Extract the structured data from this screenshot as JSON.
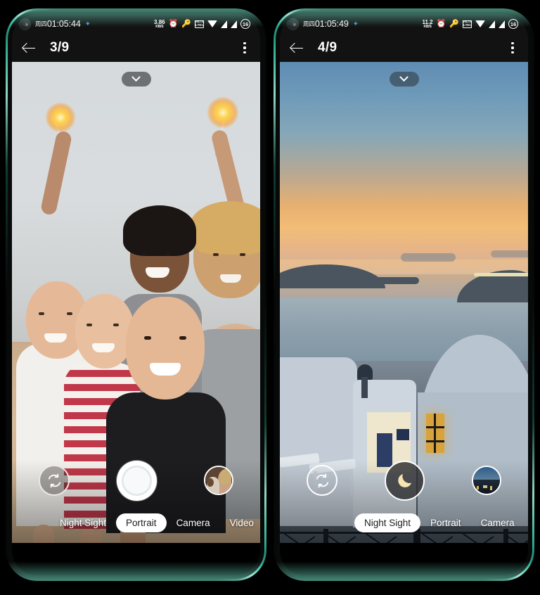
{
  "phones": [
    {
      "id": "phone-left",
      "statusbar": {
        "day_of_week": "周四",
        "time": "01:05:44",
        "net_speed_value": "3.86",
        "net_speed_unit": "KB/S",
        "alarm_icon": "alarm-clock-icon",
        "key_icon": "vpn-key-icon",
        "volte_line1": "VoLTE",
        "volte_line2": "LTE1",
        "wifi_icon": "wifi-icon",
        "signal_icon_1": "signal-bars-icon",
        "signal_icon_2": "signal-bars-icon",
        "battery_level": "16",
        "sync_icon": "sync-status-icon"
      },
      "appbar": {
        "back_icon": "back-arrow-icon",
        "title": "3/9",
        "overflow_icon": "more-options-icon"
      },
      "viewfinder": {
        "scene": "group-selfie-with-sparklers",
        "expand_icon": "chevron-down-icon"
      },
      "controls": {
        "flip_icon": "flip-camera-icon",
        "shutter_label": "shutter-button",
        "shutter_icon": "",
        "thumbnail_label": "last-photo-thumbnail",
        "thumbnail_scene": "woman-with-dog"
      },
      "modes": [
        {
          "label": "Night Sight",
          "active": false
        },
        {
          "label": "Portrait",
          "active": true
        },
        {
          "label": "Camera",
          "active": false
        },
        {
          "label": "Video",
          "active": false
        }
      ],
      "mode_scroll_offset": "60px",
      "navbar": {
        "back_icon": "nav-back-icon",
        "home_icon": "nav-home-indicator"
      }
    },
    {
      "id": "phone-right",
      "statusbar": {
        "day_of_week": "周四",
        "time": "01:05:49",
        "net_speed_value": "11.2",
        "net_speed_unit": "KB/S",
        "alarm_icon": "alarm-clock-icon",
        "key_icon": "vpn-key-icon",
        "volte_line1": "VoLTE",
        "volte_line2": "LTE1",
        "wifi_icon": "wifi-icon",
        "signal_icon_1": "signal-bars-icon",
        "signal_icon_2": "signal-bars-icon",
        "battery_level": "16",
        "sync_icon": "sync-status-icon"
      },
      "appbar": {
        "back_icon": "back-arrow-icon",
        "title": "4/9",
        "overflow_icon": "more-options-icon"
      },
      "viewfinder": {
        "scene": "santorini-sunset-seascape",
        "expand_icon": "chevron-down-icon"
      },
      "controls": {
        "flip_icon": "flip-camera-icon",
        "shutter_label": "shutter-button",
        "shutter_icon": "crescent-moon-icon",
        "thumbnail_label": "last-photo-thumbnail",
        "thumbnail_scene": "night-town-view"
      },
      "modes": [
        {
          "label": "Night Sight",
          "active": true
        },
        {
          "label": "Portrait",
          "active": false
        },
        {
          "label": "Camera",
          "active": false
        }
      ],
      "mode_scroll_offset": "106px",
      "navbar": {
        "back_icon": "nav-back-icon",
        "home_icon": "nav-home-indicator"
      }
    }
  ],
  "colors": {
    "frame_accent": "#2fae93",
    "background": "#000000",
    "statusbar_bg": "#121212",
    "mode_active_bg": "#ffffff",
    "mode_text": "#ffffff",
    "shutter_white": "#ffffff",
    "moon_yellow": "#f5e3b0"
  }
}
